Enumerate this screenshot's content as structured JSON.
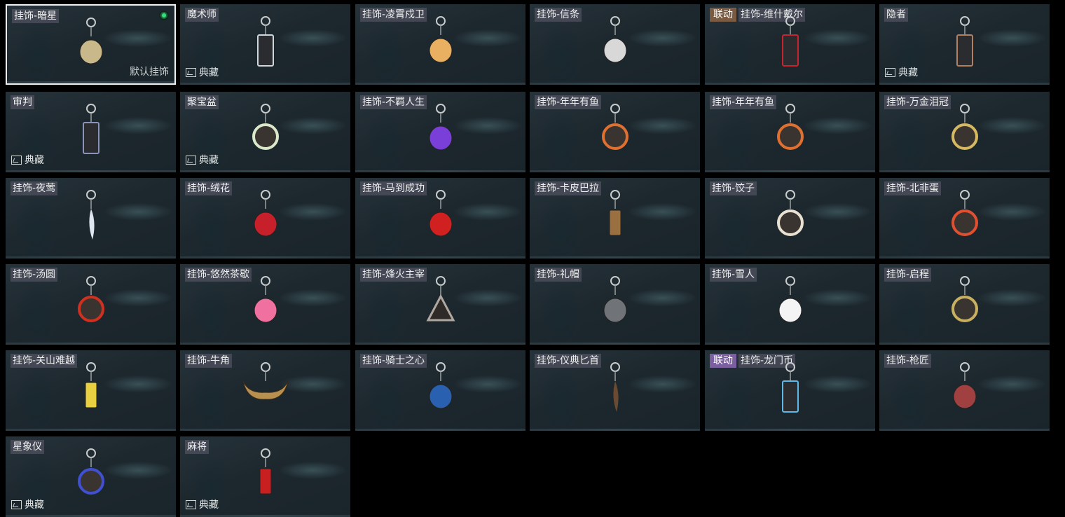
{
  "grid": {
    "default_label": "默认挂饰",
    "collection_label": "典藏",
    "items": [
      {
        "tags": [
          "挂饰-暗星"
        ],
        "collab": null,
        "collection": false,
        "selected": true,
        "equipped": true,
        "icon": "dark-star-charm-icon",
        "accent": "#c9b98a"
      },
      {
        "tags": [
          "魔术师"
        ],
        "collab": null,
        "collection": true,
        "selected": false,
        "equipped": false,
        "icon": "magician-card-charm-icon",
        "accent": "#cfd6dc"
      },
      {
        "tags": [
          "挂饰-凌霄戍卫"
        ],
        "collab": null,
        "collection": false,
        "selected": false,
        "equipped": false,
        "icon": "rocket-charm-icon",
        "accent": "#e8b060"
      },
      {
        "tags": [
          "挂饰-信条"
        ],
        "collab": null,
        "collection": false,
        "selected": false,
        "equipped": false,
        "icon": "eagle-charm-icon",
        "accent": "#d8d8d8"
      },
      {
        "tags": [
          "挂饰-维什戴尔"
        ],
        "collab": "联动",
        "collab_style": "brown",
        "collection": false,
        "selected": false,
        "equipped": false,
        "icon": "wisadel-card-charm-icon",
        "accent": "#c8242e"
      },
      {
        "tags": [
          "隐者"
        ],
        "collab": null,
        "collection": true,
        "selected": false,
        "equipped": false,
        "icon": "hermit-card-charm-icon",
        "accent": "#b08060"
      },
      {
        "tags": [
          "审判"
        ],
        "collab": null,
        "collection": true,
        "selected": false,
        "equipped": false,
        "icon": "judgement-card-charm-icon",
        "accent": "#8a94b8"
      },
      {
        "tags": [
          "聚宝盆"
        ],
        "collab": null,
        "collection": true,
        "selected": false,
        "equipped": false,
        "icon": "treasure-bowl-charm-icon",
        "accent": "#d8e8c8"
      },
      {
        "tags": [
          "挂饰-不羁人生"
        ],
        "collab": null,
        "collection": false,
        "selected": false,
        "equipped": false,
        "icon": "sneaker-charm-icon",
        "accent": "#7a3fd8"
      },
      {
        "tags": [
          "挂饰-年年有鱼"
        ],
        "collab": null,
        "collection": false,
        "selected": false,
        "equipped": false,
        "icon": "fish-charm-icon",
        "accent": "#e07030"
      },
      {
        "tags": [
          "挂饰-年年有鱼"
        ],
        "collab": null,
        "collection": false,
        "selected": false,
        "equipped": false,
        "icon": "fish-charm-icon",
        "accent": "#e07030"
      },
      {
        "tags": [
          "挂饰-万金泪冠"
        ],
        "collab": null,
        "collection": false,
        "selected": false,
        "equipped": false,
        "icon": "gold-coin-charm-icon",
        "accent": "#d6b860"
      },
      {
        "tags": [
          "挂饰-夜莺"
        ],
        "collab": null,
        "collection": false,
        "selected": false,
        "equipped": false,
        "icon": "feather-charm-icon",
        "accent": "#dfe6f0"
      },
      {
        "tags": [
          "挂饰-绒花"
        ],
        "collab": null,
        "collection": false,
        "selected": false,
        "equipped": false,
        "icon": "rose-charm-icon",
        "accent": "#c8202a"
      },
      {
        "tags": [
          "挂饰-马到成功"
        ],
        "collab": null,
        "collection": false,
        "selected": false,
        "equipped": false,
        "icon": "horse-charm-icon",
        "accent": "#d02020"
      },
      {
        "tags": [
          "挂饰-卡皮巴拉"
        ],
        "collab": null,
        "collection": false,
        "selected": false,
        "equipped": false,
        "icon": "capybara-charm-icon",
        "accent": "#9a7040"
      },
      {
        "tags": [
          "挂饰-饺子"
        ],
        "collab": null,
        "collection": false,
        "selected": false,
        "equipped": false,
        "icon": "dumpling-plate-charm-icon",
        "accent": "#e8e0d0"
      },
      {
        "tags": [
          "挂饰-北非蛋"
        ],
        "collab": null,
        "collection": false,
        "selected": false,
        "equipped": false,
        "icon": "shakshuka-charm-icon",
        "accent": "#e05030"
      },
      {
        "tags": [
          "挂饰-汤圆"
        ],
        "collab": null,
        "collection": false,
        "selected": false,
        "equipped": false,
        "icon": "tangyuan-bowl-charm-icon",
        "accent": "#d03020"
      },
      {
        "tags": [
          "挂饰-悠然茶歇"
        ],
        "collab": null,
        "collection": false,
        "selected": false,
        "equipped": false,
        "icon": "cupcake-charm-icon",
        "accent": "#f070a0"
      },
      {
        "tags": [
          "挂饰-烽火主宰"
        ],
        "collab": null,
        "collection": false,
        "selected": false,
        "equipped": false,
        "icon": "triangle-emblem-charm-icon",
        "accent": "#b0a8a0"
      },
      {
        "tags": [
          "挂饰-礼帽"
        ],
        "collab": null,
        "collection": false,
        "selected": false,
        "equipped": false,
        "icon": "top-hat-charm-icon",
        "accent": "#707478"
      },
      {
        "tags": [
          "挂饰-雪人"
        ],
        "collab": null,
        "collection": false,
        "selected": false,
        "equipped": false,
        "icon": "snowman-charm-icon",
        "accent": "#f4f4f4"
      },
      {
        "tags": [
          "挂饰-启程"
        ],
        "collab": null,
        "collection": false,
        "selected": false,
        "equipped": false,
        "icon": "compass-charm-icon",
        "accent": "#c8b060"
      },
      {
        "tags": [
          "挂饰-关山难越"
        ],
        "collab": null,
        "collection": false,
        "selected": false,
        "equipped": false,
        "icon": "gold-bar-charm-icon",
        "accent": "#e8d040"
      },
      {
        "tags": [
          "挂饰-牛角"
        ],
        "collab": null,
        "collection": false,
        "selected": false,
        "equipped": false,
        "icon": "bull-horns-charm-icon",
        "accent": "#b89050"
      },
      {
        "tags": [
          "挂饰-骑士之心"
        ],
        "collab": null,
        "collection": false,
        "selected": false,
        "equipped": false,
        "icon": "knight-cross-charm-icon",
        "accent": "#2a60b0"
      },
      {
        "tags": [
          "挂饰-仪典匕首"
        ],
        "collab": null,
        "collection": false,
        "selected": false,
        "equipped": false,
        "icon": "dagger-charm-icon",
        "accent": "#6a4a30"
      },
      {
        "tags": [
          "挂饰-龙门币"
        ],
        "collab": "联动",
        "collab_style": "purple",
        "collection": false,
        "selected": false,
        "equipped": false,
        "icon": "lungmen-coin-card-charm-icon",
        "accent": "#60b8e8"
      },
      {
        "tags": [
          "挂饰-枪匠"
        ],
        "collab": null,
        "collection": false,
        "selected": false,
        "equipped": false,
        "icon": "gunsmith-badge-charm-icon",
        "accent": "#a04040"
      },
      {
        "tags": [
          "星象仪"
        ],
        "collab": null,
        "collection": true,
        "selected": false,
        "equipped": false,
        "icon": "astrolabe-charm-icon",
        "accent": "#4050d0"
      },
      {
        "tags": [
          "麻将"
        ],
        "collab": null,
        "collection": true,
        "selected": false,
        "equipped": false,
        "icon": "mahjong-tile-charm-icon",
        "accent": "#c82020"
      }
    ]
  }
}
